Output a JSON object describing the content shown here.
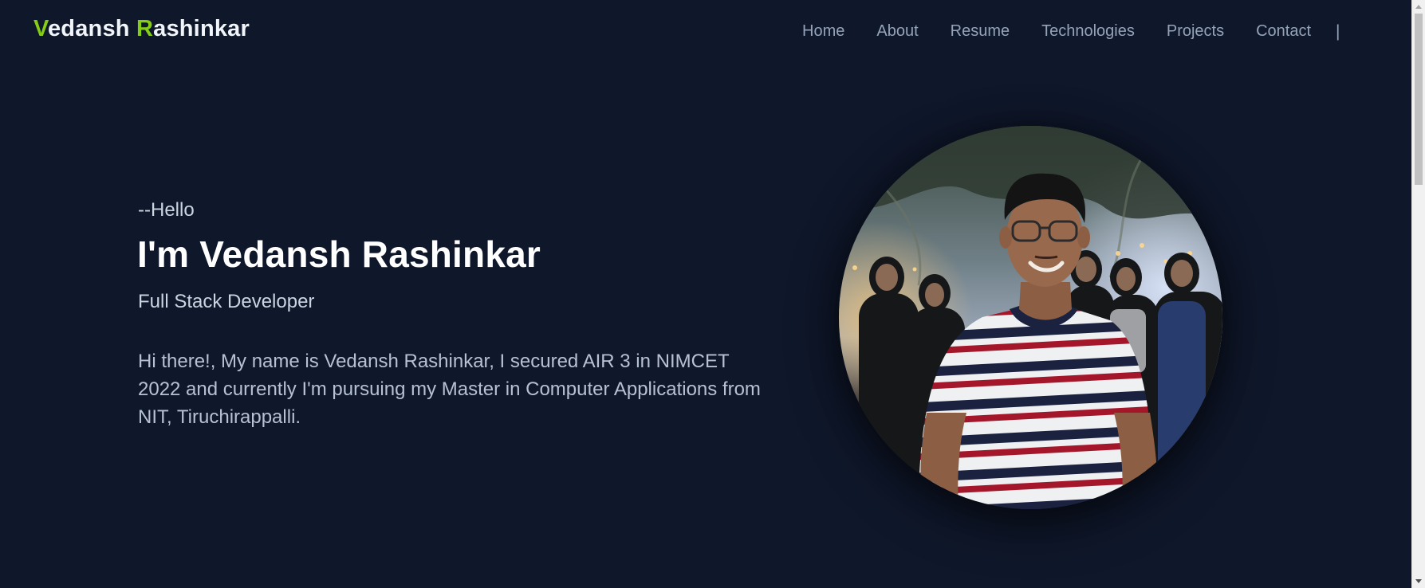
{
  "header": {
    "logo": {
      "first_initial": "V",
      "first_rest": "edansh",
      "last_initial": "R",
      "last_rest": "ashinkar"
    },
    "nav": [
      {
        "label": "Home"
      },
      {
        "label": "About"
      },
      {
        "label": "Resume"
      },
      {
        "label": "Technologies"
      },
      {
        "label": "Projects"
      },
      {
        "label": "Contact"
      }
    ],
    "separator": "|"
  },
  "hero": {
    "greeting": "--Hello",
    "headline": "I'm Vedansh Rashinkar",
    "role": "Full Stack Developer",
    "bio": "Hi there!, My name is Vedansh Rashinkar, I secured AIR 3 in NIMCET 2022 and currently I'm pursuing my Master in Computer Applications from NIT, Tiruchirappalli."
  },
  "theme": {
    "background": "#0f172a",
    "accent": "#84cc16",
    "nav_text": "#94a3b8",
    "heading_text": "#ffffff",
    "body_text": "#b6c2d3"
  }
}
